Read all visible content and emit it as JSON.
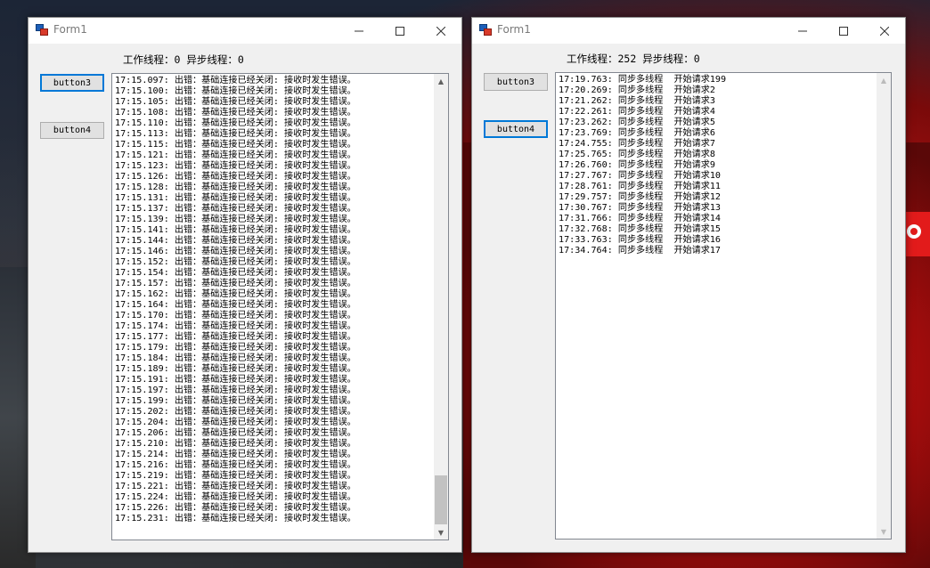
{
  "left_window": {
    "title": "Form1",
    "status": "工作线程：0 异步线程：0",
    "buttons": {
      "button3": "button3",
      "button4": "button4"
    },
    "log_lines": [
      "17:15.097: 出错：基础连接已经关闭: 接收时发生错误。",
      "17:15.100: 出错：基础连接已经关闭: 接收时发生错误。",
      "17:15.105: 出错：基础连接已经关闭: 接收时发生错误。",
      "17:15.108: 出错：基础连接已经关闭: 接收时发生错误。",
      "17:15.110: 出错：基础连接已经关闭: 接收时发生错误。",
      "17:15.113: 出错：基础连接已经关闭: 接收时发生错误。",
      "17:15.115: 出错：基础连接已经关闭: 接收时发生错误。",
      "17:15.121: 出错：基础连接已经关闭: 接收时发生错误。",
      "17:15.123: 出错：基础连接已经关闭: 接收时发生错误。",
      "17:15.126: 出错：基础连接已经关闭: 接收时发生错误。",
      "17:15.128: 出错：基础连接已经关闭: 接收时发生错误。",
      "17:15.131: 出错：基础连接已经关闭: 接收时发生错误。",
      "17:15.137: 出错：基础连接已经关闭: 接收时发生错误。",
      "17:15.139: 出错：基础连接已经关闭: 接收时发生错误。",
      "17:15.141: 出错：基础连接已经关闭: 接收时发生错误。",
      "17:15.144: 出错：基础连接已经关闭: 接收时发生错误。",
      "17:15.146: 出错：基础连接已经关闭: 接收时发生错误。",
      "17:15.152: 出错：基础连接已经关闭: 接收时发生错误。",
      "17:15.154: 出错：基础连接已经关闭: 接收时发生错误。",
      "17:15.157: 出错：基础连接已经关闭: 接收时发生错误。",
      "17:15.162: 出错：基础连接已经关闭: 接收时发生错误。",
      "17:15.164: 出错：基础连接已经关闭: 接收时发生错误。",
      "17:15.170: 出错：基础连接已经关闭: 接收时发生错误。",
      "17:15.174: 出错：基础连接已经关闭: 接收时发生错误。",
      "17:15.177: 出错：基础连接已经关闭: 接收时发生错误。",
      "17:15.179: 出错：基础连接已经关闭: 接收时发生错误。",
      "17:15.184: 出错：基础连接已经关闭: 接收时发生错误。",
      "17:15.189: 出错：基础连接已经关闭: 接收时发生错误。",
      "17:15.191: 出错：基础连接已经关闭: 接收时发生错误。",
      "17:15.197: 出错：基础连接已经关闭: 接收时发生错误。",
      "17:15.199: 出错：基础连接已经关闭: 接收时发生错误。",
      "17:15.202: 出错：基础连接已经关闭: 接收时发生错误。",
      "17:15.204: 出错：基础连接已经关闭: 接收时发生错误。",
      "17:15.206: 出错：基础连接已经关闭: 接收时发生错误。",
      "17:15.210: 出错：基础连接已经关闭: 接收时发生错误。",
      "17:15.214: 出错：基础连接已经关闭: 接收时发生错误。",
      "17:15.216: 出错：基础连接已经关闭: 接收时发生错误。",
      "17:15.219: 出错：基础连接已经关闭: 接收时发生错误。",
      "17:15.221: 出错：基础连接已经关闭: 接收时发生错误。",
      "17:15.224: 出错：基础连接已经关闭: 接收时发生错误。",
      "17:15.226: 出错：基础连接已经关闭: 接收时发生错误。",
      "17:15.231: 出错：基础连接已经关闭: 接收时发生错误。"
    ]
  },
  "right_window": {
    "title": "Form1",
    "status": "工作线程：252 异步线程：0",
    "buttons": {
      "button3": "button3",
      "button4": "button4"
    },
    "log_lines": [
      "17:19.763: 同步多线程  开始请求199",
      "17:20.269: 同步多线程  开始请求2",
      "17:21.262: 同步多线程  开始请求3",
      "17:22.261: 同步多线程  开始请求4",
      "17:23.262: 同步多线程  开始请求5",
      "17:23.769: 同步多线程  开始请求6",
      "17:24.755: 同步多线程  开始请求7",
      "17:25.765: 同步多线程  开始请求8",
      "17:26.760: 同步多线程  开始请求9",
      "17:27.767: 同步多线程  开始请求10",
      "17:28.761: 同步多线程  开始请求11",
      "17:29.757: 同步多线程  开始请求12",
      "17:30.767: 同步多线程  开始请求13",
      "17:31.766: 同步多线程  开始请求14",
      "17:32.768: 同步多线程  开始请求15",
      "17:33.763: 同步多线程  开始请求16",
      "17:34.764: 同步多线程  开始请求17"
    ]
  },
  "icons": [
    "app-icon",
    "minimize-icon",
    "maximize-icon",
    "close-icon",
    "scroll-up-icon",
    "scroll-down-icon"
  ]
}
